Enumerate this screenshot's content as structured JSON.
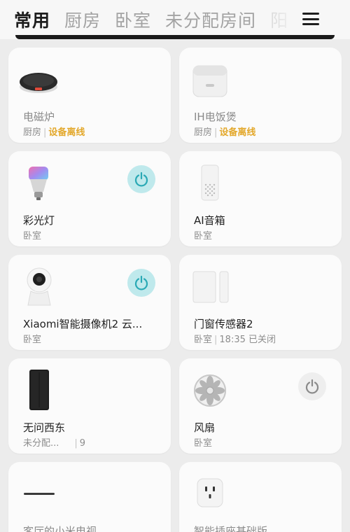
{
  "tabs": [
    {
      "label": "常用",
      "active": true
    },
    {
      "label": "厨房",
      "active": false
    },
    {
      "label": "卧室",
      "active": false
    },
    {
      "label": "未分配房间",
      "active": false
    },
    {
      "label": "阳",
      "active": false
    }
  ],
  "devices": [
    {
      "name": "电磁炉",
      "room": "厨房",
      "status": "设备离线",
      "icon": "induction-cooker-icon"
    },
    {
      "name": "IH电饭煲",
      "room": "厨房",
      "status": "设备离线",
      "icon": "rice-cooker-icon"
    },
    {
      "name": "彩光灯",
      "room": "卧室",
      "power": "on",
      "icon": "color-bulb-icon"
    },
    {
      "name": "AI音箱",
      "room": "卧室",
      "icon": "ai-speaker-icon"
    },
    {
      "name": "Xiaomi智能摄像机2 云...",
      "room": "卧室",
      "power": "on",
      "icon": "camera-icon"
    },
    {
      "name": "门窗传感器2",
      "room": "卧室",
      "status": "18:35 已关闭",
      "icon": "door-sensor-icon"
    },
    {
      "name": "无问西东",
      "room": "未分配...",
      "status": "9",
      "icon": "router-icon"
    },
    {
      "name": "风扇",
      "room": "卧室",
      "power": "off",
      "icon": "fan-icon"
    },
    {
      "name": "客厅的小米电视",
      "icon": "tv-icon"
    },
    {
      "name": "智能插座基础版",
      "icon": "smart-plug-icon"
    }
  ],
  "colors": {
    "power_on": "#bfe9ec",
    "power_on_icon": "#2aa9b5",
    "warning": "#e3a82b"
  }
}
